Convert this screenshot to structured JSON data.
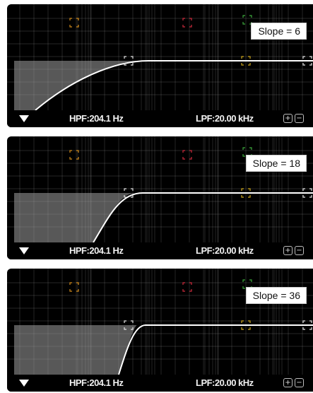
{
  "panels": [
    {
      "slope_label": "Slope = 6",
      "hpf_label": "HPF:",
      "hpf_value": "204.1 Hz",
      "lpf_label": "LPF:",
      "lpf_value": "20.00 kHz",
      "slope": 6
    },
    {
      "slope_label": "Slope = 18",
      "hpf_label": "HPF:",
      "hpf_value": "204.1 Hz",
      "lpf_label": "LPF:",
      "lpf_value": "20.00 kHz",
      "slope": 18
    },
    {
      "slope_label": "Slope = 36",
      "hpf_label": "HPF:",
      "hpf_value": "204.1 Hz",
      "lpf_label": "LPF:",
      "lpf_value": "20.00 kHz",
      "slope": 36
    }
  ],
  "icons": {
    "menu": "menu-triangle-icon",
    "zoom_in": "plus-box-icon",
    "zoom_out": "minus-box-icon"
  },
  "glyphs": {
    "zoom_in": "+",
    "zoom_out": "−"
  },
  "colors": {
    "background": "#000000",
    "grid": "#8a8a8a",
    "curve": "#ffffff",
    "fill": "#9a9a9a",
    "handle_orange": "#d08a1a",
    "handle_red": "#cc2b3c",
    "handle_green": "#3da83d",
    "handle_yellow": "#c9a31c",
    "handle_white": "#e0e0e0"
  }
}
